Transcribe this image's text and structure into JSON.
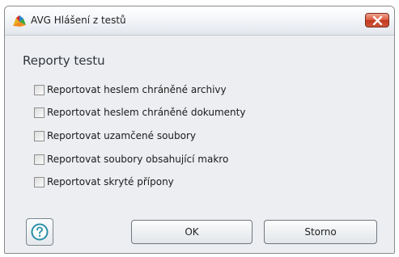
{
  "window": {
    "title": "AVG Hlášení z testů",
    "app_icon": "avg-logo-icon",
    "close_icon": "close-icon"
  },
  "section": {
    "title": "Reporty testu"
  },
  "options": [
    {
      "label": "Reportovat heslem chráněné archivy",
      "checked": false
    },
    {
      "label": "Reportovat heslem chráněné dokumenty",
      "checked": false
    },
    {
      "label": "Reportovat uzamčené soubory",
      "checked": false
    },
    {
      "label": "Reportovat soubory obsahující makro",
      "checked": false
    },
    {
      "label": "Reportovat skryté přípony",
      "checked": false
    }
  ],
  "buttons": {
    "help_icon": "help-icon",
    "ok_label": "OK",
    "cancel_label": "Storno"
  },
  "colors": {
    "close_button": "#d0563a",
    "help_icon": "#2a8fa8",
    "background": "#eceef1"
  }
}
